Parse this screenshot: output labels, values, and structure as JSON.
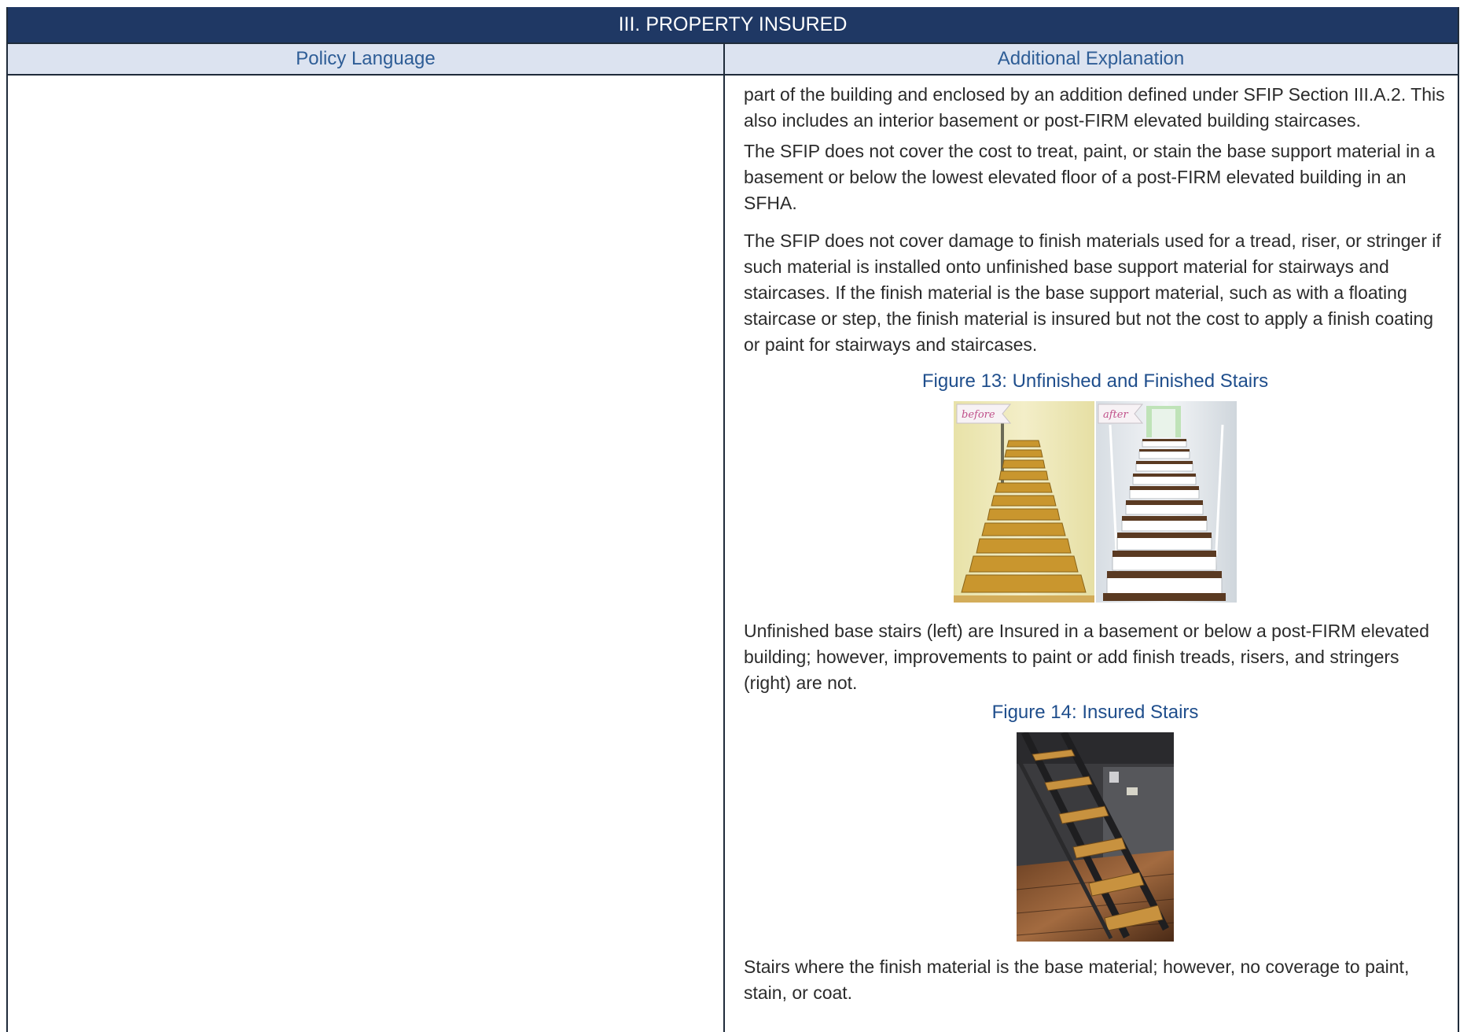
{
  "table": {
    "title": "III. PROPERTY INSURED",
    "headers": {
      "left": "Policy Language",
      "right": "Additional Explanation"
    }
  },
  "explanation": {
    "paragraphs": [
      "part of the building and enclosed by an addition defined under SFIP Section III.A.2. This also includes an interior basement or post-FIRM elevated building staircases.",
      "The SFIP does not cover the cost to treat, paint, or stain the base support material in a basement or below the lowest elevated floor of a post-FIRM elevated building in an SFHA.",
      "The SFIP does not cover damage to finish materials used for a tread, riser, or stringer if such material is installed onto unfinished base support material for stairways and staircases. If the finish material is the base support material, such as with a floating staircase or step, the finish material is insured but not the cost to apply a finish coating or paint for stairways and staircases."
    ],
    "figure13": {
      "caption": "Figure 13: Unfinished and Finished Stairs",
      "tag_before": "before",
      "tag_after": "after",
      "description": "Unfinished base stairs (left) are Insured in a basement or below a post-FIRM elevated building; however, improvements to paint or add finish treads, risers, and stringers (right) are not."
    },
    "figure14": {
      "caption": "Figure 14: Insured Stairs",
      "description": "Stairs where the finish material is the base material; however, no coverage to paint, stain, or coat."
    }
  }
}
